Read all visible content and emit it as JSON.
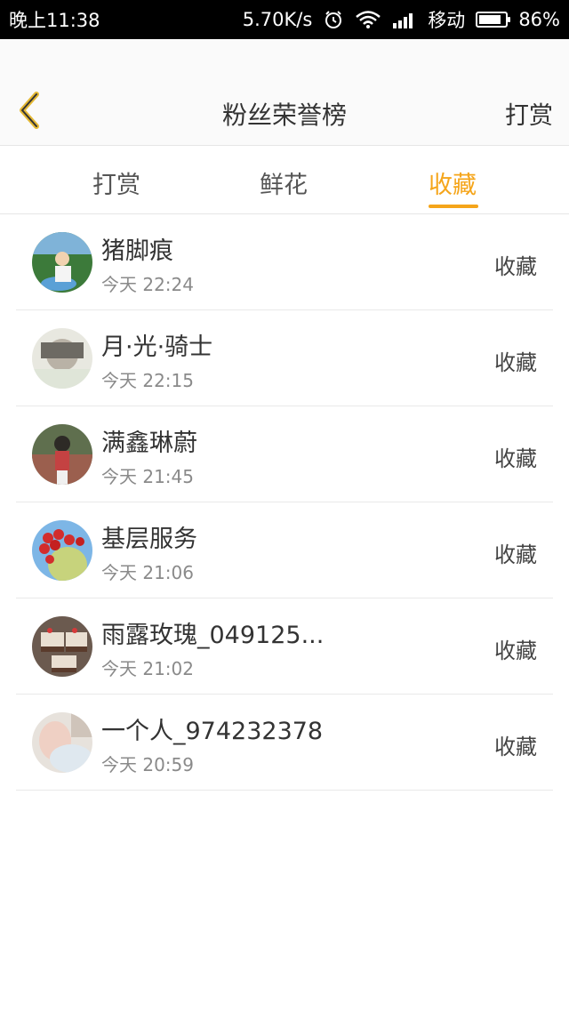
{
  "status_bar": {
    "time": "晚上11:38",
    "speed": "5.70K/s",
    "carrier": "移动",
    "battery": "86%",
    "icons": [
      "alarm-icon",
      "wifi-icon",
      "signal-icon",
      "battery-icon"
    ]
  },
  "header": {
    "title": "粉丝荣誉榜",
    "action": "打赏",
    "back_icon": "chevron-left-icon"
  },
  "tabs": [
    {
      "label": "打赏",
      "active": false
    },
    {
      "label": "鲜花",
      "active": false
    },
    {
      "label": "收藏",
      "active": true
    }
  ],
  "accent_color": "#f5a51a",
  "list": [
    {
      "name": "猪脚痕",
      "time": "今天 22:24",
      "action": "收藏",
      "avatar_icon": "user-avatar"
    },
    {
      "name": "月·光·骑士",
      "time": "今天 22:15",
      "action": "收藏",
      "avatar_icon": "user-avatar"
    },
    {
      "name": "满鑫琳蔚",
      "time": "今天 21:45",
      "action": "收藏",
      "avatar_icon": "user-avatar"
    },
    {
      "name": "基层服务",
      "time": "今天 21:06",
      "action": "收藏",
      "avatar_icon": "user-avatar"
    },
    {
      "name": "雨露玫瑰_049125...",
      "time": "今天 21:02",
      "action": "收藏",
      "avatar_icon": "user-avatar"
    },
    {
      "name": "一个人_974232378",
      "time": "今天 20:59",
      "action": "收藏",
      "avatar_icon": "user-avatar"
    }
  ]
}
